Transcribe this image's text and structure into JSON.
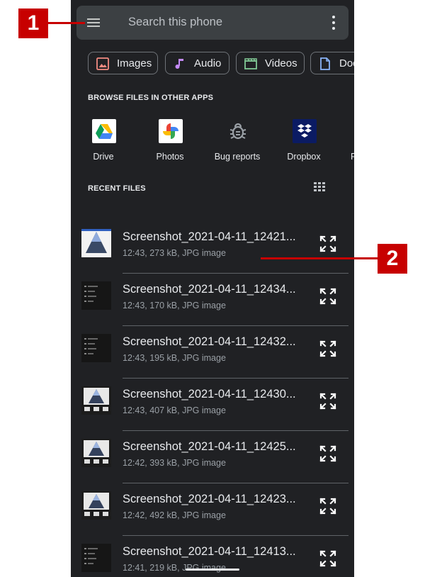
{
  "search": {
    "placeholder": "Search this phone"
  },
  "chips": [
    {
      "label": "Images",
      "icon": "image-icon",
      "color": "#f28b82"
    },
    {
      "label": "Audio",
      "icon": "music-note-icon",
      "color": "#c58af9"
    },
    {
      "label": "Videos",
      "icon": "clapperboard-icon",
      "color": "#81c995"
    },
    {
      "label": "Docs",
      "icon": "document-icon",
      "color": "#8ab4f8"
    }
  ],
  "browse": {
    "header": "BROWSE FILES IN OTHER APPS",
    "apps": [
      {
        "label": "Drive",
        "icon": "google-drive-icon"
      },
      {
        "label": "Photos",
        "icon": "google-photos-icon"
      },
      {
        "label": "Bug reports",
        "icon": "bug-icon"
      },
      {
        "label": "Dropbox",
        "icon": "dropbox-icon"
      },
      {
        "label": "F",
        "icon": "partial-app-icon"
      }
    ]
  },
  "recent": {
    "header": "RECENT FILES",
    "view_icon": "grid-view-icon",
    "files": [
      {
        "name": "Screenshot_2021-04-11_12421...",
        "meta": "12:43, 273 kB, JPG image",
        "thumb": "pyramid"
      },
      {
        "name": "Screenshot_2021-04-11_12434...",
        "meta": "12:43, 170 kB, JPG image",
        "thumb": "dark"
      },
      {
        "name": "Screenshot_2021-04-11_12432...",
        "meta": "12:43, 195 kB, JPG image",
        "thumb": "dark"
      },
      {
        "name": "Screenshot_2021-04-11_12430...",
        "meta": "12:43, 407 kB, JPG image",
        "thumb": "pyramid-dark"
      },
      {
        "name": "Screenshot_2021-04-11_12425...",
        "meta": "12:42, 393 kB, JPG image",
        "thumb": "pyramid-dark"
      },
      {
        "name": "Screenshot_2021-04-11_12423...",
        "meta": "12:42, 492 kB, JPG image",
        "thumb": "pyramid-dark"
      },
      {
        "name": "Screenshot_2021-04-11_12413...",
        "meta": "12:41, 219 kB, JPG image",
        "thumb": "dark"
      }
    ]
  },
  "callouts": [
    {
      "label": "1",
      "color": "#c70000"
    },
    {
      "label": "2",
      "color": "#c70000"
    }
  ]
}
